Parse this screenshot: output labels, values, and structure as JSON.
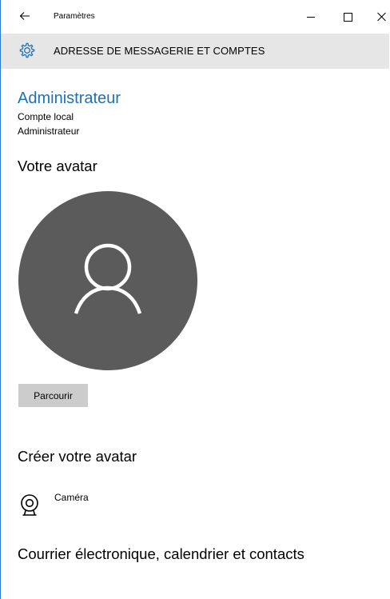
{
  "window": {
    "title": "Paramètres"
  },
  "header": {
    "title": "ADRESSE DE MESSAGERIE ET COMPTES"
  },
  "account": {
    "name": "Administrateur",
    "type": "Compte local",
    "role": "Administrateur"
  },
  "avatar_section": {
    "heading": "Votre avatar",
    "browse_label": "Parcourir"
  },
  "create_section": {
    "heading": "Créer votre avatar",
    "camera_label": "Caméra"
  },
  "mail_section": {
    "heading": "Courrier électronique, calendrier et contacts"
  },
  "colors": {
    "accent": "#1e70b8",
    "header_bg": "#e6e6e6",
    "avatar_bg": "#5b5b5b",
    "button_bg": "#cccccc"
  },
  "icons": {
    "back": "back-arrow-icon",
    "minimize": "minimize-icon",
    "maximize": "maximize-icon",
    "close": "close-icon",
    "header": "gear-icon",
    "avatar": "person-icon",
    "camera": "webcam-icon"
  }
}
